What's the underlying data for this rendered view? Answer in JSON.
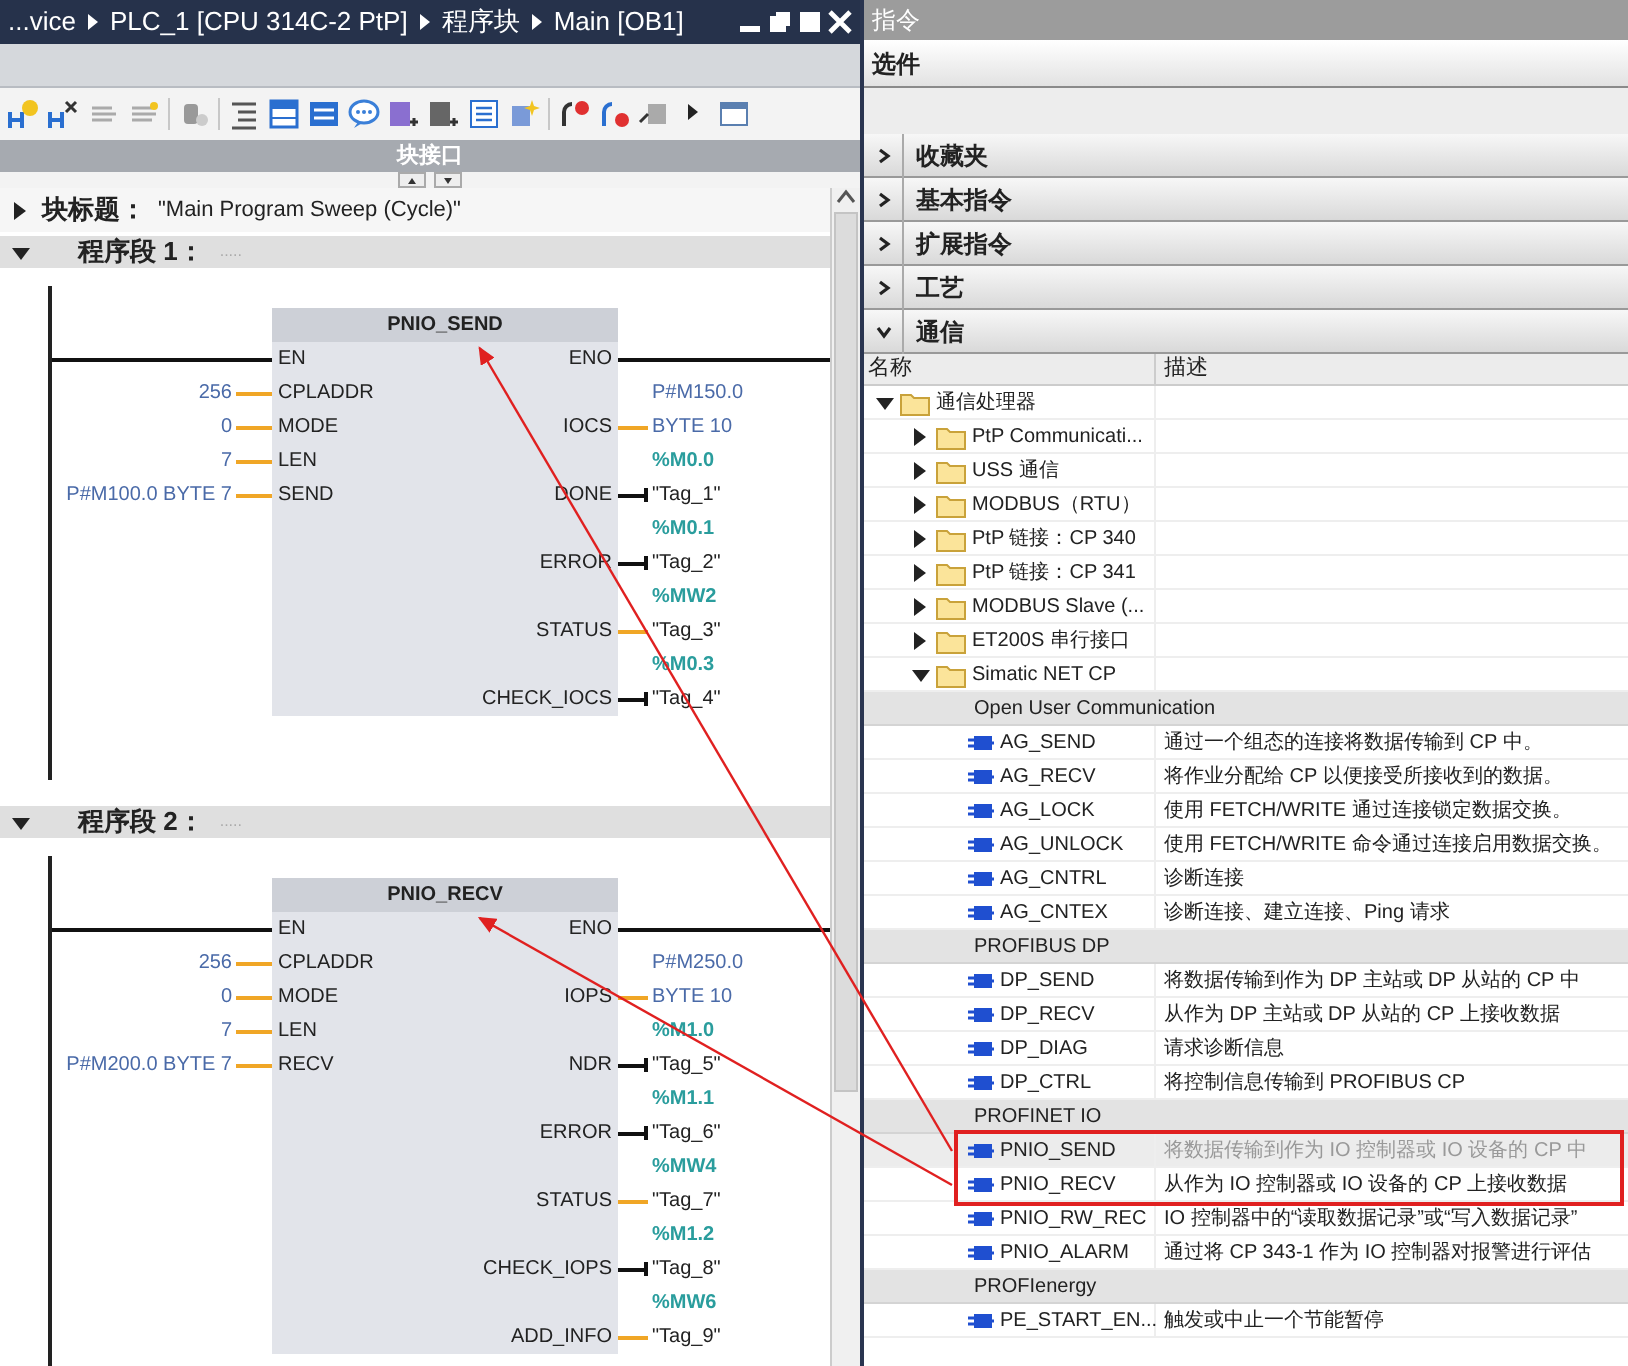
{
  "editor": {
    "breadcrumb": [
      "...vice",
      "PLC_1 [CPU 314C-2 PtP]",
      "程序块",
      "Main [OB1]"
    ],
    "interface_bar": {
      "label": "块接口"
    },
    "block_title": {
      "label": "块标题：",
      "value": "\"Main Program Sweep (Cycle)\"",
      "expanded": false
    },
    "networks": [
      {
        "title": "程序段 1：",
        "comment": ".....",
        "expanded": true,
        "block": {
          "name": "PNIO_SEND",
          "inputs": [
            {
              "pin": "EN",
              "kind": "enable"
            },
            {
              "pin": "CPLADDR",
              "kind": "value",
              "operand": "256"
            },
            {
              "pin": "MODE",
              "kind": "value",
              "operand": "0"
            },
            {
              "pin": "LEN",
              "kind": "value",
              "operand": "7"
            },
            {
              "pin": "SEND",
              "kind": "value",
              "operand": "P#M100.0 BYTE 7"
            }
          ],
          "outputs": [
            {
              "pin": "ENO",
              "kind": "enable"
            },
            {
              "pin": "IOCS",
              "kind": "pointer",
              "address": "P#M150.0",
              "operand": "BYTE 10"
            },
            {
              "pin": "DONE",
              "kind": "bool",
              "address": "%M0.0",
              "operand": "\"Tag_1\""
            },
            {
              "pin": "ERROR",
              "kind": "bool",
              "address": "%M0.1",
              "operand": "\"Tag_2\""
            },
            {
              "pin": "STATUS",
              "kind": "word",
              "address": "%MW2",
              "operand": "\"Tag_3\""
            },
            {
              "pin": "CHECK_IOCS",
              "kind": "bool",
              "address": "%M0.3",
              "operand": "\"Tag_4\""
            }
          ]
        }
      },
      {
        "title": "程序段 2：",
        "comment": ".....",
        "expanded": true,
        "block": {
          "name": "PNIO_RECV",
          "inputs": [
            {
              "pin": "EN",
              "kind": "enable"
            },
            {
              "pin": "CPLADDR",
              "kind": "value",
              "operand": "256"
            },
            {
              "pin": "MODE",
              "kind": "value",
              "operand": "0"
            },
            {
              "pin": "LEN",
              "kind": "value",
              "operand": "7"
            },
            {
              "pin": "RECV",
              "kind": "value",
              "operand": "P#M200.0 BYTE 7"
            }
          ],
          "outputs": [
            {
              "pin": "ENO",
              "kind": "enable"
            },
            {
              "pin": "IOPS",
              "kind": "pointer",
              "address": "P#M250.0",
              "operand": "BYTE 10"
            },
            {
              "pin": "NDR",
              "kind": "bool",
              "address": "%M1.0",
              "operand": "\"Tag_5\""
            },
            {
              "pin": "ERROR",
              "kind": "bool",
              "address": "%M1.1",
              "operand": "\"Tag_6\""
            },
            {
              "pin": "STATUS",
              "kind": "word",
              "address": "%MW4",
              "operand": "\"Tag_7\""
            },
            {
              "pin": "CHECK_IOPS",
              "kind": "bool",
              "address": "%M1.2",
              "operand": "\"Tag_8\""
            },
            {
              "pin": "ADD_INFO",
              "kind": "word",
              "address": "%MW6",
              "operand": "\"Tag_9\""
            }
          ]
        }
      }
    ]
  },
  "instructions": {
    "title": "指令",
    "options": "选件",
    "sections": [
      {
        "label": "收藏夹",
        "expanded": false
      },
      {
        "label": "基本指令",
        "expanded": false
      },
      {
        "label": "扩展指令",
        "expanded": false
      },
      {
        "label": "工艺",
        "expanded": false
      },
      {
        "label": "通信",
        "expanded": true
      }
    ],
    "columns": [
      "名称",
      "描述"
    ],
    "tree": [
      {
        "label": "通信处理器",
        "expanded": true,
        "children": [
          {
            "label": "PtP Communicati...",
            "expanded": false
          },
          {
            "label": "USS 通信",
            "expanded": false
          },
          {
            "label": "MODBUS（RTU）",
            "expanded": false
          },
          {
            "label": "PtP 链接：CP 340",
            "expanded": false
          },
          {
            "label": "PtP 链接：CP 341",
            "expanded": false
          },
          {
            "label": "MODBUS Slave (...",
            "expanded": false
          },
          {
            "label": "ET200S 串行接口",
            "expanded": false
          },
          {
            "label": "Simatic NET CP",
            "expanded": true,
            "groups": [
              {
                "title": "Open User Communication",
                "items": [
                  {
                    "name": "AG_SEND",
                    "description": "通过一个组态的连接将数据传输到 CP 中。",
                    "selected": false,
                    "highlighted": false
                  },
                  {
                    "name": "AG_RECV",
                    "description": "将作业分配给 CP 以便接受所接收到的数据。",
                    "selected": false,
                    "highlighted": false
                  },
                  {
                    "name": "AG_LOCK",
                    "description": "使用 FETCH/WRITE 通过连接锁定数据交换。",
                    "selected": false,
                    "highlighted": false
                  },
                  {
                    "name": "AG_UNLOCK",
                    "description": "使用 FETCH/WRITE 命令通过连接启用数据交换。",
                    "selected": false,
                    "highlighted": false
                  },
                  {
                    "name": "AG_CNTRL",
                    "description": "诊断连接",
                    "selected": false,
                    "highlighted": false
                  },
                  {
                    "name": "AG_CNTEX",
                    "description": "诊断连接、建立连接、Ping 请求",
                    "selected": false,
                    "highlighted": false
                  }
                ]
              },
              {
                "title": "PROFIBUS DP",
                "items": [
                  {
                    "name": "DP_SEND",
                    "description": "将数据传输到作为 DP 主站或 DP 从站的 CP 中",
                    "selected": false,
                    "highlighted": false
                  },
                  {
                    "name": "DP_RECV",
                    "description": "从作为 DP 主站或 DP 从站的 CP 上接收数据",
                    "selected": false,
                    "highlighted": false
                  },
                  {
                    "name": "DP_DIAG",
                    "description": "请求诊断信息",
                    "selected": false,
                    "highlighted": false
                  },
                  {
                    "name": "DP_CTRL",
                    "description": "将控制信息传输到 PROFIBUS CP",
                    "selected": false,
                    "highlighted": false
                  }
                ]
              },
              {
                "title": "PROFINET IO",
                "items": [
                  {
                    "name": "PNIO_SEND",
                    "description": "将数据传输到作为 IO 控制器或 IO 设备的 CP 中",
                    "selected": true,
                    "highlighted": true
                  },
                  {
                    "name": "PNIO_RECV",
                    "description": "从作为 IO 控制器或 IO 设备的 CP 上接收数据",
                    "selected": false,
                    "highlighted": true
                  },
                  {
                    "name": "PNIO_RW_REC",
                    "description": "IO 控制器中的“读取数据记录”或“写入数据记录”",
                    "selected": false,
                    "highlighted": false
                  },
                  {
                    "name": "PNIO_ALARM",
                    "description": "通过将 CP 343-1 作为 IO 控制器对报警进行评估",
                    "selected": false,
                    "highlighted": false
                  }
                ]
              },
              {
                "title": "PROFIenergy",
                "items": [
                  {
                    "name": "PE_START_EN...",
                    "description": "触发或中止一个节能暂停",
                    "selected": false,
                    "highlighted": false
                  }
                ]
              }
            ]
          }
        ]
      }
    ]
  }
}
